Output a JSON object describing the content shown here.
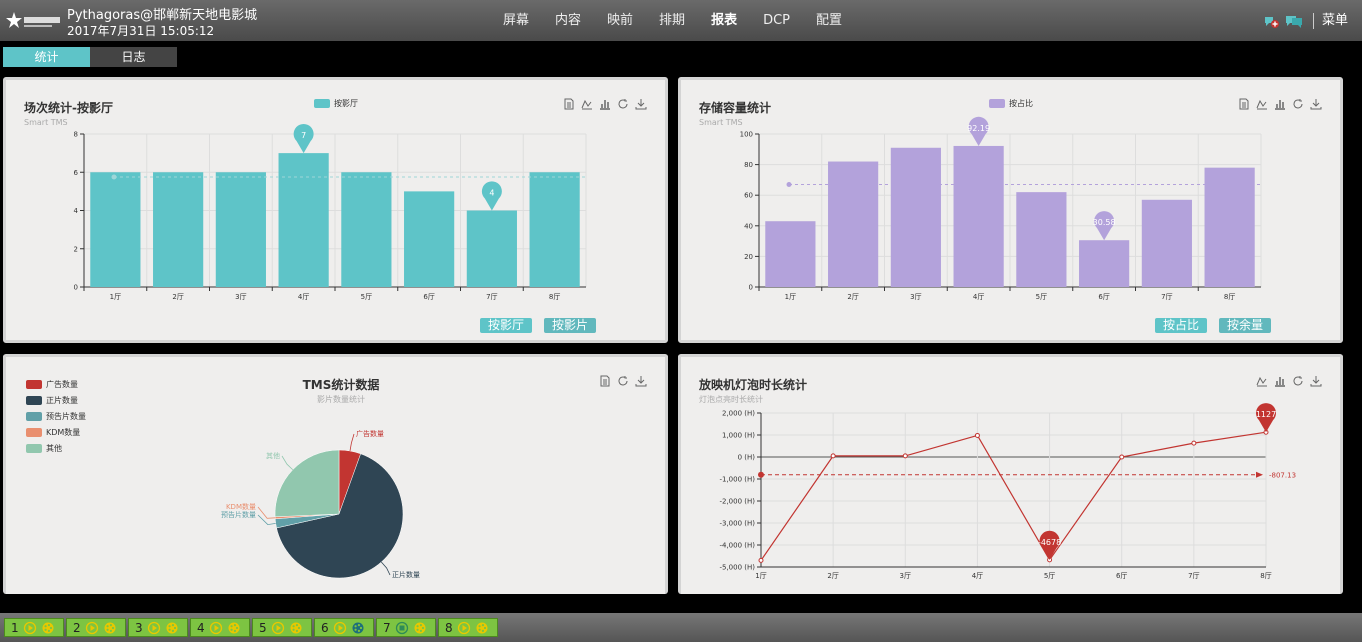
{
  "header": {
    "title": "Pythagoras@邯郸新天地电影城",
    "datetime": "2017年7月31日 15:05:12",
    "nav": [
      "屏幕",
      "内容",
      "映前",
      "排期",
      "报表",
      "DCP",
      "配置"
    ],
    "active_nav": "报表",
    "menu_label": "菜单"
  },
  "tabs": [
    "统计",
    "日志"
  ],
  "panel1": {
    "title": "场次统计-按影厅",
    "subtitle": "Smart TMS",
    "legend": "按影厅",
    "buttons": [
      "按影厅",
      "按影片"
    ]
  },
  "panel2": {
    "title": "存储容量统计",
    "subtitle": "Smart TMS",
    "legend": "按占比",
    "buttons": [
      "按占比",
      "按余量"
    ]
  },
  "panel3": {
    "title": "TMS统计数据",
    "subtitle": "影片数量统计",
    "legend": [
      "广告数量",
      "正片数量",
      "预告片数量",
      "KDM数量",
      "其他"
    ]
  },
  "panel4": {
    "title": "放映机灯泡时长统计",
    "subtitle": "灯泡点亮时长统计"
  },
  "colors": {
    "teal": "#5ec4c8",
    "purple": "#b3a2db",
    "red": "#c23531",
    "navy": "#2f4554",
    "steel": "#61a0a8",
    "orange": "#e98f6f",
    "mint": "#91c7ae",
    "hall_green": "#7dc442"
  },
  "chart_data": [
    {
      "type": "bar",
      "categories": [
        "1厅",
        "2厅",
        "3厅",
        "4厅",
        "5厅",
        "6厅",
        "7厅",
        "8厅"
      ],
      "series": [
        {
          "name": "按影厅",
          "values": [
            6,
            6,
            6,
            7,
            6,
            5,
            4,
            6
          ]
        }
      ],
      "ylim": [
        0,
        8
      ],
      "yticks": [
        0,
        2,
        4,
        6,
        8
      ],
      "markpoints": [
        {
          "category": "4厅",
          "value": 7
        },
        {
          "category": "7厅",
          "value": 4
        }
      ],
      "average_line": 5.75
    },
    {
      "type": "bar",
      "categories": [
        "1厅",
        "2厅",
        "3厅",
        "4厅",
        "5厅",
        "6厅",
        "7厅",
        "8厅"
      ],
      "series": [
        {
          "name": "按占比",
          "values": [
            43,
            82,
            91,
            92.19,
            62,
            30.58,
            57,
            78
          ]
        }
      ],
      "ylim": [
        0,
        100
      ],
      "yticks": [
        0,
        20,
        40,
        60,
        80,
        100
      ],
      "markpoints": [
        {
          "category": "4厅",
          "value": 92.19
        },
        {
          "category": "6厅",
          "value": 30.58
        }
      ],
      "average_line": 67
    },
    {
      "type": "pie",
      "slices": [
        {
          "name": "广告数量",
          "value": 5.5
        },
        {
          "name": "正片数量",
          "value": 66
        },
        {
          "name": "预告片数量",
          "value": 2.3
        },
        {
          "name": "KDM数量",
          "value": 0.5
        },
        {
          "name": "其他",
          "value": 25.7
        }
      ]
    },
    {
      "type": "line",
      "categories": [
        "1厅",
        "2厅",
        "3厅",
        "4厅",
        "5厅",
        "6厅",
        "7厅",
        "8厅"
      ],
      "series": [
        {
          "values": [
            -4700,
            50,
            50,
            980,
            -4678,
            0,
            630,
            1127
          ]
        }
      ],
      "ylim": [
        -5000,
        2000
      ],
      "ytick_labels": [
        "2,000 (H)",
        "1,000 (H)",
        "0 (H)",
        "-1,000 (H)",
        "-2,000 (H)",
        "-3,000 (H)",
        "-4,000 (H)",
        "-5,000 (H)"
      ],
      "markpoints": [
        {
          "category": "8厅",
          "value": 1127
        },
        {
          "category": "5厅",
          "value": -4678
        }
      ],
      "average_line": -807.13,
      "average_label": "-807.13"
    }
  ],
  "halls": [
    "1",
    "2",
    "3",
    "4",
    "5",
    "6",
    "7",
    "8"
  ]
}
